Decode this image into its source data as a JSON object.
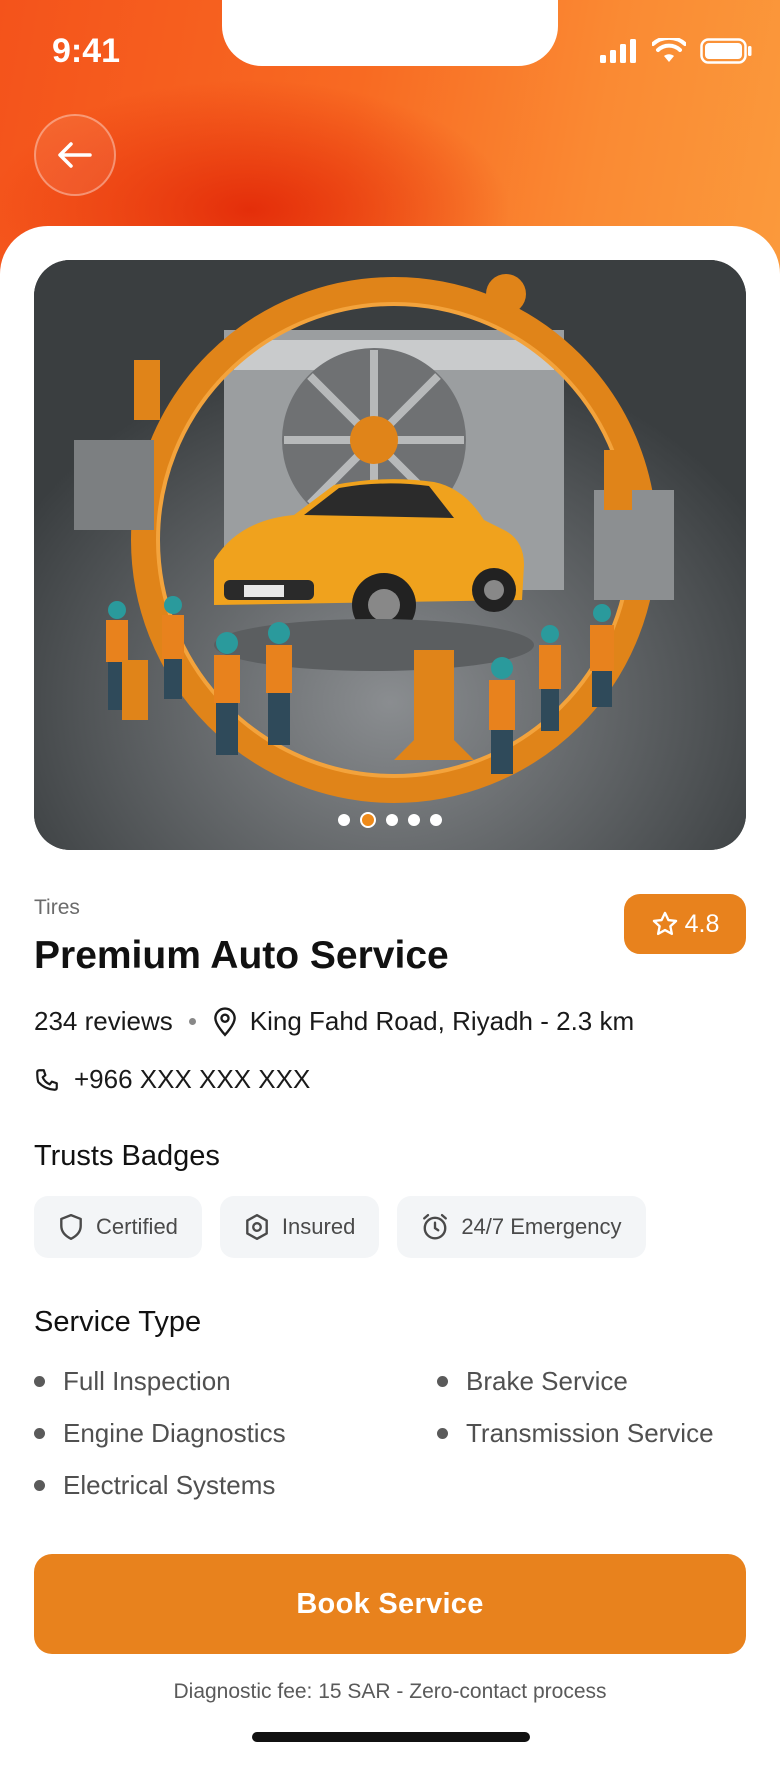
{
  "status_bar": {
    "time": "9:41"
  },
  "colors": {
    "accent": "#e8821d",
    "header_start": "#f4531b",
    "header_end": "#fb9a3c"
  },
  "carousel": {
    "count": 5,
    "active_index": 1
  },
  "shop": {
    "category": "Tires",
    "name": "Premium Auto Service",
    "rating": "4.8",
    "reviews": "234 reviews",
    "location": "King Fahd Road, Riyadh - 2.3 km",
    "phone": "+966 XXX XXX XXX"
  },
  "trust": {
    "title": "Trusts Badges",
    "badges": [
      {
        "label": "Certified",
        "icon": "shield-icon"
      },
      {
        "label": "Insured",
        "icon": "hexagon-badge-icon"
      },
      {
        "label": "24/7 Emergency",
        "icon": "alarm-clock-icon"
      }
    ]
  },
  "services": {
    "title": "Service Type",
    "items": [
      "Full Inspection",
      "Brake Service",
      "Engine Diagnostics",
      "Transmission Service",
      "Electrical Systems"
    ]
  },
  "cta": {
    "label": "Book Service"
  },
  "footer": {
    "note": "Diagnostic fee: 15 SAR - Zero-contact process"
  }
}
